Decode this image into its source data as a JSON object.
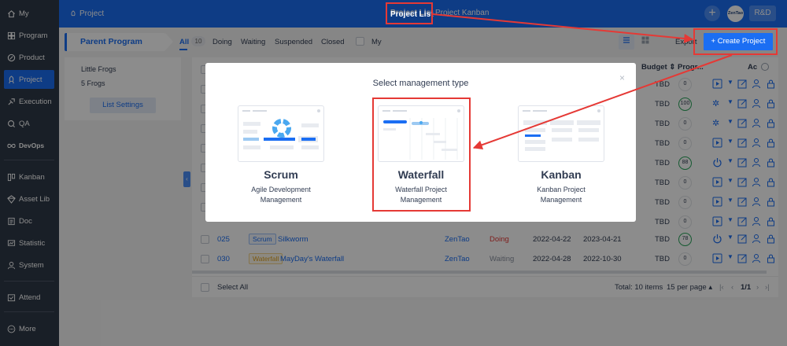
{
  "sidebar": {
    "items": [
      {
        "label": "My",
        "icon": "home-icon"
      },
      {
        "label": "Program",
        "icon": "program-icon"
      },
      {
        "label": "Product",
        "icon": "product-icon"
      },
      {
        "label": "Project",
        "icon": "project-icon"
      },
      {
        "label": "Execution",
        "icon": "execution-icon"
      },
      {
        "label": "QA",
        "icon": "qa-icon"
      },
      {
        "label": "DevOps",
        "icon": "devops-icon"
      },
      {
        "label": "Kanban",
        "icon": "kanban-icon"
      },
      {
        "label": "Asset Lib",
        "icon": "asset-lib-icon"
      },
      {
        "label": "Doc",
        "icon": "doc-icon"
      },
      {
        "label": "Statistic",
        "icon": "statistic-icon"
      },
      {
        "label": "System",
        "icon": "system-icon"
      },
      {
        "label": "Attend",
        "icon": "attend-icon"
      },
      {
        "label": "More",
        "icon": "more-icon"
      }
    ],
    "active": "Project",
    "active_color": "#1b6ef3"
  },
  "header": {
    "section": "Project",
    "tabs": [
      {
        "label": "Project List"
      },
      {
        "label": "Project Kanban"
      }
    ],
    "avatar_text": "ZenTao",
    "user_button": "R&D",
    "bg_color": "#1b6ef3"
  },
  "subbar": {
    "parent_program": "Parent Program",
    "filters": [
      {
        "label": "All",
        "count": "10"
      },
      {
        "label": "Doing"
      },
      {
        "label": "Waiting"
      },
      {
        "label": "Suspended"
      },
      {
        "label": "Closed"
      },
      {
        "label": "My"
      }
    ],
    "export_label": "Export",
    "create_label": "+ Create Project"
  },
  "left_panel": {
    "items": [
      "Little Frogs",
      "5 Frogs"
    ],
    "settings_label": "List Settings"
  },
  "table": {
    "headers": {
      "budget": "Budget",
      "progress": "Progr...",
      "actions": "Ac"
    },
    "rows": [
      {
        "budget": "TBD",
        "progress": "0"
      },
      {
        "budget": "TBD",
        "progress": "100"
      },
      {
        "budget": "TBD",
        "progress": "0"
      },
      {
        "budget": "TBD",
        "progress": "0"
      },
      {
        "budget": "TBD",
        "progress": "88"
      },
      {
        "budget": "TBD",
        "progress": "0"
      },
      {
        "budget": "TBD",
        "progress": "0"
      },
      {
        "budget": "TBD",
        "progress": "0"
      },
      {
        "id": "025",
        "type": "Scrum",
        "name": "Silkworm",
        "pm": "ZenTao",
        "status": "Doing",
        "start": "2022-04-22",
        "end": "2023-04-21",
        "budget": "TBD",
        "progress": "78"
      },
      {
        "id": "030",
        "type": "Waterfall",
        "name": "MayDay's Waterfall",
        "pm": "ZenTao",
        "status": "Waiting",
        "start": "2022-04-28",
        "end": "2022-10-30",
        "budget": "TBD",
        "progress": "0"
      }
    ],
    "select_all": "Select All",
    "total": "Total: 10 items",
    "per_page": "15 per page",
    "page": "1/1"
  },
  "modal": {
    "title": "Select management type",
    "close": "×",
    "types": [
      {
        "name": "Scrum",
        "desc1": "Agile Development",
        "desc2": "Management"
      },
      {
        "name": "Waterfall",
        "desc1": "Waterfall Project",
        "desc2": "Management"
      },
      {
        "name": "Kanban",
        "desc1": "Kanban Project",
        "desc2": "Management"
      }
    ]
  },
  "colors": {
    "highlight": "#e53935",
    "tag_scrum": "#1b6ef3",
    "tag_waterfall": "#e0a11b",
    "status_doing": "#e53935",
    "progress_green": "#2aa55b"
  }
}
